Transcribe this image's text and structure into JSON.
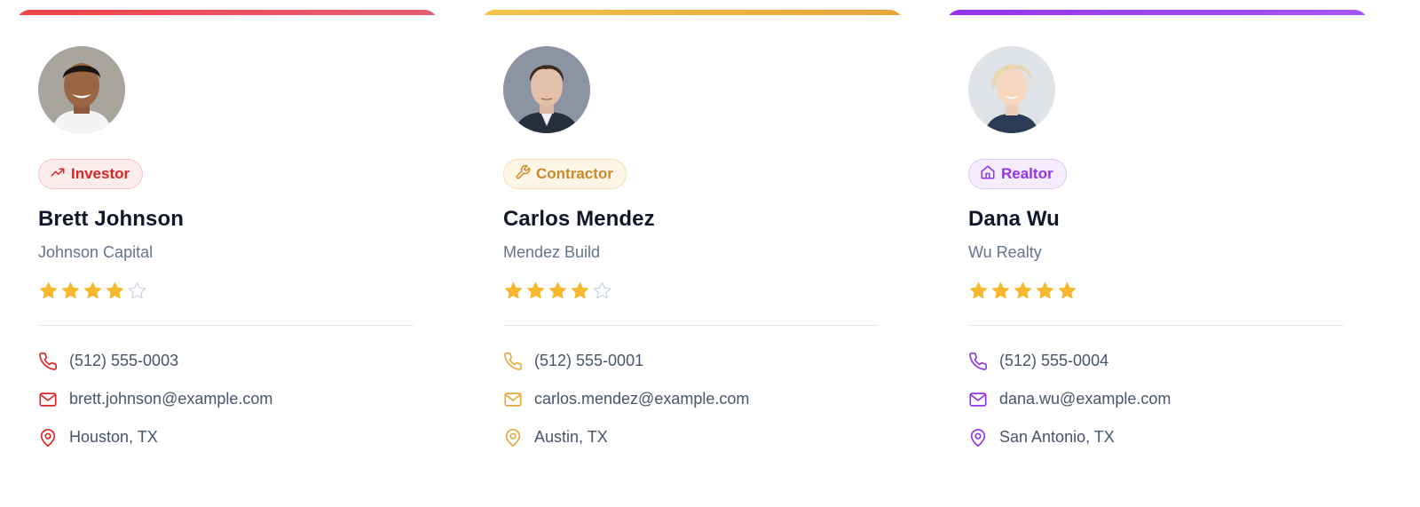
{
  "cards": [
    {
      "role": "Investor",
      "role_icon": "trending-up-icon",
      "name": "Brett Johnson",
      "company": "Johnson Capital",
      "rating": 4,
      "rating_max": 5,
      "phone": "(512) 555-0003",
      "email": "brett.johnson@example.com",
      "location": "Houston, TX",
      "accent": "#dc2626",
      "bar_gradient": [
        "#ef4444",
        "#e85d75"
      ],
      "badge_bg": "#fdecec",
      "badge_border": "#f9c4c4"
    },
    {
      "role": "Contractor",
      "role_icon": "wrench-icon",
      "name": "Carlos Mendez",
      "company": "Mendez Build",
      "rating": 4,
      "rating_max": 5,
      "phone": "(512) 555-0001",
      "email": "carlos.mendez@example.com",
      "location": "Austin, TX",
      "accent": "#e5a83c",
      "bar_gradient": [
        "#f5c44a",
        "#eaa33a"
      ],
      "badge_bg": "#fdf5e6",
      "badge_border": "#f7deb0",
      "badge_text": "#c98a2b"
    },
    {
      "role": "Realtor",
      "role_icon": "home-icon",
      "name": "Dana Wu",
      "company": "Wu Realty",
      "rating": 5,
      "rating_max": 5,
      "phone": "(512) 555-0004",
      "email": "dana.wu@example.com",
      "location": "San Antonio, TX",
      "accent": "#9333ea",
      "bar_gradient": [
        "#9333ea",
        "#a855f7"
      ],
      "badge_bg": "#f5edfd",
      "badge_border": "#dfc6f8"
    }
  ],
  "colors": {
    "star_filled": "#f5b82e",
    "star_empty": "#cbd5e1"
  }
}
